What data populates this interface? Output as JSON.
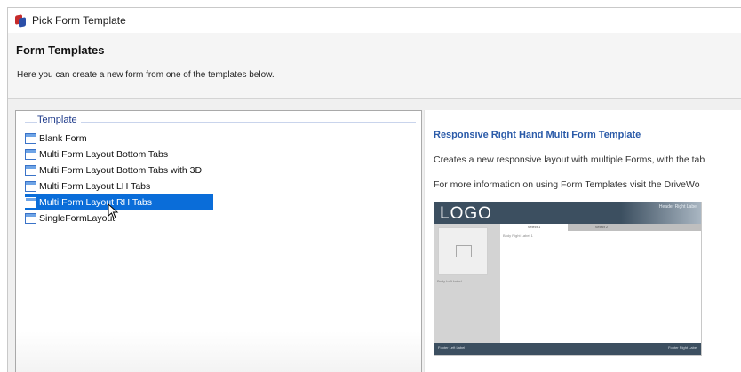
{
  "window": {
    "title": "Pick Form Template",
    "icon": "app-form-icon"
  },
  "header": {
    "title": "Form Templates",
    "subtitle": "Here you can create a new form from one of the templates below."
  },
  "tree": {
    "group_label": "Template",
    "items": [
      {
        "label": "Blank Form",
        "icon": "form-icon",
        "selected": false
      },
      {
        "label": "Multi Form Layout Bottom Tabs",
        "icon": "form-icon",
        "selected": false
      },
      {
        "label": "Multi Form Layout Bottom Tabs with 3D",
        "icon": "form-icon",
        "selected": false
      },
      {
        "label": "Multi Form Layout LH Tabs",
        "icon": "form-icon",
        "selected": false
      },
      {
        "label": "Multi Form Layout RH Tabs",
        "icon": "form-icon",
        "selected": true
      },
      {
        "label": "SingleFormLayout",
        "icon": "form-icon",
        "selected": false
      }
    ],
    "selection_color": "#0a6dd9"
  },
  "preview": {
    "title": "Responsive Right Hand Multi Form Template",
    "description": "Creates a new responsive layout with multiple Forms, with the tab",
    "more_info": "For more information on using Form Templates visit the DriveWo",
    "title_color": "#2a5aa8",
    "thumbnail": {
      "logo": "LOGO",
      "top_right": "Header Right Label",
      "tab1": "Select 1",
      "tab2": "Select 2",
      "body_label": "Body Right Label 1",
      "left_label": "Body Left Label",
      "footer_left": "Footer Left Label",
      "footer_right": "Footer Right Label"
    }
  }
}
